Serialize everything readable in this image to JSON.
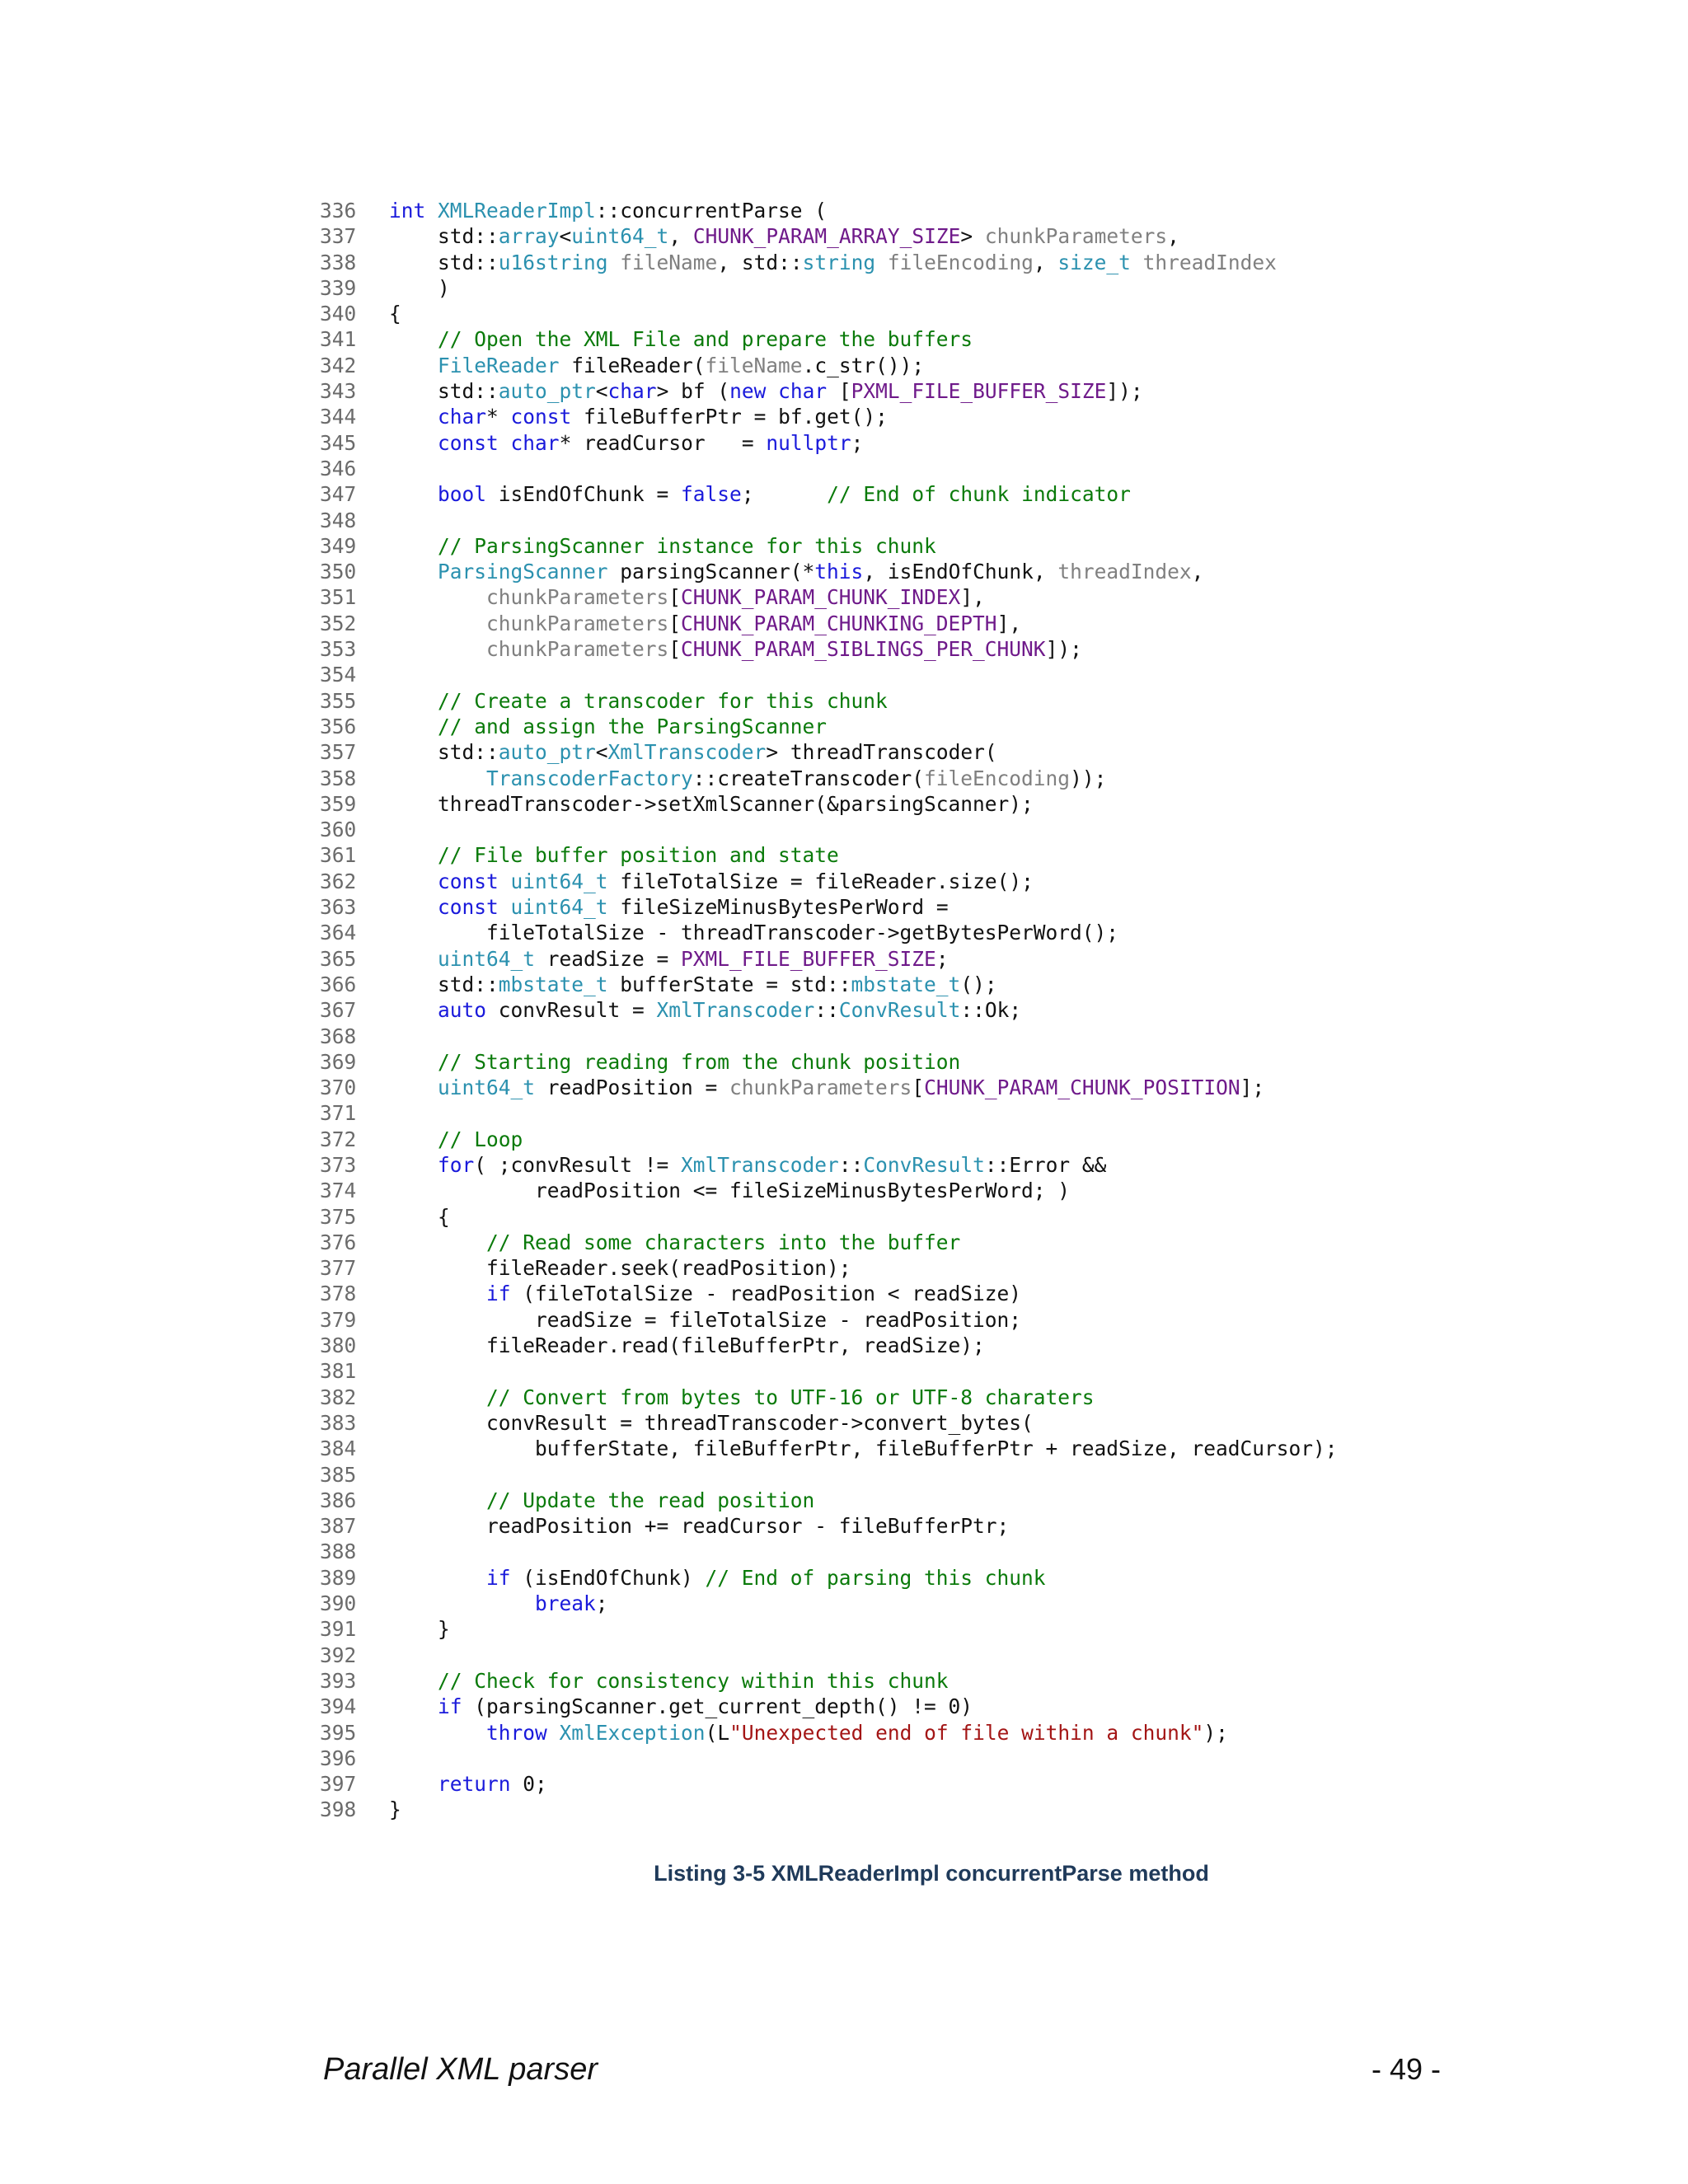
{
  "colors": {
    "keyword": "#1a1adb",
    "type": "#2b91af",
    "macro": "#6f1a8a",
    "variable": "#808080",
    "comment": "#0a7a0a",
    "string": "#a31515",
    "plain": "#111111",
    "line_number": "#6b6b6b",
    "caption": "#1f3a5a"
  },
  "code": {
    "lines": [
      {
        "num": "336",
        "tokens": [
          [
            "kw",
            "int"
          ],
          [
            "pl",
            " "
          ],
          [
            "ty",
            "XMLReaderImpl"
          ],
          [
            "pl",
            "::concurrentParse ("
          ]
        ]
      },
      {
        "num": "337",
        "tokens": [
          [
            "pl",
            "    std::"
          ],
          [
            "ty",
            "array"
          ],
          [
            "pl",
            "<"
          ],
          [
            "ty",
            "uint64_t"
          ],
          [
            "pl",
            ", "
          ],
          [
            "mac",
            "CHUNK_PARAM_ARRAY_SIZE"
          ],
          [
            "pl",
            "> "
          ],
          [
            "var",
            "chunkParameters"
          ],
          [
            "pl",
            ","
          ]
        ]
      },
      {
        "num": "338",
        "tokens": [
          [
            "pl",
            "    std::"
          ],
          [
            "ty",
            "u16string"
          ],
          [
            "pl",
            " "
          ],
          [
            "var",
            "fileName"
          ],
          [
            "pl",
            ", std::"
          ],
          [
            "ty",
            "string"
          ],
          [
            "pl",
            " "
          ],
          [
            "var",
            "fileEncoding"
          ],
          [
            "pl",
            ", "
          ],
          [
            "ty",
            "size_t"
          ],
          [
            "pl",
            " "
          ],
          [
            "var",
            "threadIndex"
          ]
        ]
      },
      {
        "num": "339",
        "tokens": [
          [
            "pl",
            "    )"
          ]
        ]
      },
      {
        "num": "340",
        "tokens": [
          [
            "pl",
            "{"
          ]
        ]
      },
      {
        "num": "341",
        "tokens": [
          [
            "pl",
            "    "
          ],
          [
            "cm",
            "// Open the XML File and prepare the buffers"
          ]
        ]
      },
      {
        "num": "342",
        "tokens": [
          [
            "pl",
            "    "
          ],
          [
            "ty",
            "FileReader"
          ],
          [
            "pl",
            " fileReader("
          ],
          [
            "var",
            "fileName"
          ],
          [
            "pl",
            ".c_str());"
          ]
        ]
      },
      {
        "num": "343",
        "tokens": [
          [
            "pl",
            "    std::"
          ],
          [
            "ty",
            "auto_ptr"
          ],
          [
            "pl",
            "<"
          ],
          [
            "kw",
            "char"
          ],
          [
            "pl",
            "> bf ("
          ],
          [
            "kw",
            "new"
          ],
          [
            "pl",
            " "
          ],
          [
            "kw",
            "char"
          ],
          [
            "pl",
            " ["
          ],
          [
            "mac",
            "PXML_FILE_BUFFER_SIZE"
          ],
          [
            "pl",
            "]);"
          ]
        ]
      },
      {
        "num": "344",
        "tokens": [
          [
            "pl",
            "    "
          ],
          [
            "kw",
            "char"
          ],
          [
            "pl",
            "* "
          ],
          [
            "kw",
            "const"
          ],
          [
            "pl",
            " fileBufferPtr = bf.get();"
          ]
        ]
      },
      {
        "num": "345",
        "tokens": [
          [
            "pl",
            "    "
          ],
          [
            "kw",
            "const"
          ],
          [
            "pl",
            " "
          ],
          [
            "kw",
            "char"
          ],
          [
            "pl",
            "* readCursor   = "
          ],
          [
            "kw",
            "nullptr"
          ],
          [
            "pl",
            ";"
          ]
        ]
      },
      {
        "num": "346",
        "tokens": []
      },
      {
        "num": "347",
        "tokens": [
          [
            "pl",
            "    "
          ],
          [
            "kw",
            "bool"
          ],
          [
            "pl",
            " isEndOfChunk = "
          ],
          [
            "kw",
            "false"
          ],
          [
            "pl",
            ";      "
          ],
          [
            "cm",
            "// End of chunk indicator"
          ]
        ]
      },
      {
        "num": "348",
        "tokens": []
      },
      {
        "num": "349",
        "tokens": [
          [
            "pl",
            "    "
          ],
          [
            "cm",
            "// ParsingScanner instance for this chunk"
          ]
        ]
      },
      {
        "num": "350",
        "tokens": [
          [
            "pl",
            "    "
          ],
          [
            "ty",
            "ParsingScanner"
          ],
          [
            "pl",
            " parsingScanner(*"
          ],
          [
            "kw",
            "this"
          ],
          [
            "pl",
            ", isEndOfChunk, "
          ],
          [
            "var",
            "threadIndex"
          ],
          [
            "pl",
            ","
          ]
        ]
      },
      {
        "num": "351",
        "tokens": [
          [
            "pl",
            "        "
          ],
          [
            "var",
            "chunkParameters"
          ],
          [
            "pl",
            "["
          ],
          [
            "mac",
            "CHUNK_PARAM_CHUNK_INDEX"
          ],
          [
            "pl",
            "],"
          ]
        ]
      },
      {
        "num": "352",
        "tokens": [
          [
            "pl",
            "        "
          ],
          [
            "var",
            "chunkParameters"
          ],
          [
            "pl",
            "["
          ],
          [
            "mac",
            "CHUNK_PARAM_CHUNKING_DEPTH"
          ],
          [
            "pl",
            "],"
          ]
        ]
      },
      {
        "num": "353",
        "tokens": [
          [
            "pl",
            "        "
          ],
          [
            "var",
            "chunkParameters"
          ],
          [
            "pl",
            "["
          ],
          [
            "mac",
            "CHUNK_PARAM_SIBLINGS_PER_CHUNK"
          ],
          [
            "pl",
            "]);"
          ]
        ]
      },
      {
        "num": "354",
        "tokens": []
      },
      {
        "num": "355",
        "tokens": [
          [
            "pl",
            "    "
          ],
          [
            "cm",
            "// Create a transcoder for this chunk"
          ]
        ]
      },
      {
        "num": "356",
        "tokens": [
          [
            "pl",
            "    "
          ],
          [
            "cm",
            "// and assign the ParsingScanner"
          ]
        ]
      },
      {
        "num": "357",
        "tokens": [
          [
            "pl",
            "    std::"
          ],
          [
            "ty",
            "auto_ptr"
          ],
          [
            "pl",
            "<"
          ],
          [
            "ty",
            "XmlTranscoder"
          ],
          [
            "pl",
            "> threadTranscoder("
          ]
        ]
      },
      {
        "num": "358",
        "tokens": [
          [
            "pl",
            "        "
          ],
          [
            "ty",
            "TranscoderFactory"
          ],
          [
            "pl",
            "::createTranscoder("
          ],
          [
            "var",
            "fileEncoding"
          ],
          [
            "pl",
            "));"
          ]
        ]
      },
      {
        "num": "359",
        "tokens": [
          [
            "pl",
            "    threadTranscoder->setXmlScanner(&parsingScanner);"
          ]
        ]
      },
      {
        "num": "360",
        "tokens": []
      },
      {
        "num": "361",
        "tokens": [
          [
            "pl",
            "    "
          ],
          [
            "cm",
            "// File buffer position and state"
          ]
        ]
      },
      {
        "num": "362",
        "tokens": [
          [
            "pl",
            "    "
          ],
          [
            "kw",
            "const"
          ],
          [
            "pl",
            " "
          ],
          [
            "ty",
            "uint64_t"
          ],
          [
            "pl",
            " fileTotalSize = fileReader.size();"
          ]
        ]
      },
      {
        "num": "363",
        "tokens": [
          [
            "pl",
            "    "
          ],
          [
            "kw",
            "const"
          ],
          [
            "pl",
            " "
          ],
          [
            "ty",
            "uint64_t"
          ],
          [
            "pl",
            " fileSizeMinusBytesPerWord ="
          ]
        ]
      },
      {
        "num": "364",
        "tokens": [
          [
            "pl",
            "        fileTotalSize - threadTranscoder->getBytesPerWord();"
          ]
        ]
      },
      {
        "num": "365",
        "tokens": [
          [
            "pl",
            "    "
          ],
          [
            "ty",
            "uint64_t"
          ],
          [
            "pl",
            " readSize = "
          ],
          [
            "mac",
            "PXML_FILE_BUFFER_SIZE"
          ],
          [
            "pl",
            ";"
          ]
        ]
      },
      {
        "num": "366",
        "tokens": [
          [
            "pl",
            "    std::"
          ],
          [
            "ty",
            "mbstate_t"
          ],
          [
            "pl",
            " bufferState = std::"
          ],
          [
            "ty",
            "mbstate_t"
          ],
          [
            "pl",
            "();"
          ]
        ]
      },
      {
        "num": "367",
        "tokens": [
          [
            "pl",
            "    "
          ],
          [
            "kw",
            "auto"
          ],
          [
            "pl",
            " convResult = "
          ],
          [
            "ty",
            "XmlTranscoder"
          ],
          [
            "pl",
            "::"
          ],
          [
            "ty",
            "ConvResult"
          ],
          [
            "pl",
            "::Ok;"
          ]
        ]
      },
      {
        "num": "368",
        "tokens": []
      },
      {
        "num": "369",
        "tokens": [
          [
            "pl",
            "    "
          ],
          [
            "cm",
            "// Starting reading from the chunk position"
          ]
        ]
      },
      {
        "num": "370",
        "tokens": [
          [
            "pl",
            "    "
          ],
          [
            "ty",
            "uint64_t"
          ],
          [
            "pl",
            " readPosition = "
          ],
          [
            "var",
            "chunkParameters"
          ],
          [
            "pl",
            "["
          ],
          [
            "mac",
            "CHUNK_PARAM_CHUNK_POSITION"
          ],
          [
            "pl",
            "];"
          ]
        ]
      },
      {
        "num": "371",
        "tokens": []
      },
      {
        "num": "372",
        "tokens": [
          [
            "pl",
            "    "
          ],
          [
            "cm",
            "// Loop"
          ]
        ]
      },
      {
        "num": "373",
        "tokens": [
          [
            "pl",
            "    "
          ],
          [
            "kw",
            "for"
          ],
          [
            "pl",
            "( ;convResult != "
          ],
          [
            "ty",
            "XmlTranscoder"
          ],
          [
            "pl",
            "::"
          ],
          [
            "ty",
            "ConvResult"
          ],
          [
            "pl",
            "::Error &&"
          ]
        ]
      },
      {
        "num": "374",
        "tokens": [
          [
            "pl",
            "            readPosition <= fileSizeMinusBytesPerWord; )"
          ]
        ]
      },
      {
        "num": "375",
        "tokens": [
          [
            "pl",
            "    {"
          ]
        ]
      },
      {
        "num": "376",
        "tokens": [
          [
            "pl",
            "        "
          ],
          [
            "cm",
            "// Read some characters into the buffer"
          ]
        ]
      },
      {
        "num": "377",
        "tokens": [
          [
            "pl",
            "        fileReader.seek(readPosition);"
          ]
        ]
      },
      {
        "num": "378",
        "tokens": [
          [
            "pl",
            "        "
          ],
          [
            "kw",
            "if"
          ],
          [
            "pl",
            " (fileTotalSize - readPosition < readSize)"
          ]
        ]
      },
      {
        "num": "379",
        "tokens": [
          [
            "pl",
            "            readSize = fileTotalSize - readPosition;"
          ]
        ]
      },
      {
        "num": "380",
        "tokens": [
          [
            "pl",
            "        fileReader.read(fileBufferPtr, readSize);"
          ]
        ]
      },
      {
        "num": "381",
        "tokens": []
      },
      {
        "num": "382",
        "tokens": [
          [
            "pl",
            "        "
          ],
          [
            "cm",
            "// Convert from bytes to UTF-16 or UTF-8 charaters"
          ]
        ]
      },
      {
        "num": "383",
        "tokens": [
          [
            "pl",
            "        convResult = threadTranscoder->convert_bytes("
          ]
        ]
      },
      {
        "num": "384",
        "tokens": [
          [
            "pl",
            "            bufferState, fileBufferPtr, fileBufferPtr + readSize, readCursor);"
          ]
        ]
      },
      {
        "num": "385",
        "tokens": []
      },
      {
        "num": "386",
        "tokens": [
          [
            "pl",
            "        "
          ],
          [
            "cm",
            "// Update the read position"
          ]
        ]
      },
      {
        "num": "387",
        "tokens": [
          [
            "pl",
            "        readPosition += readCursor - fileBufferPtr;"
          ]
        ]
      },
      {
        "num": "388",
        "tokens": []
      },
      {
        "num": "389",
        "tokens": [
          [
            "pl",
            "        "
          ],
          [
            "kw",
            "if"
          ],
          [
            "pl",
            " (isEndOfChunk) "
          ],
          [
            "cm",
            "// End of parsing this chunk"
          ]
        ]
      },
      {
        "num": "390",
        "tokens": [
          [
            "pl",
            "            "
          ],
          [
            "kw",
            "break"
          ],
          [
            "pl",
            ";"
          ]
        ]
      },
      {
        "num": "391",
        "tokens": [
          [
            "pl",
            "    }"
          ]
        ]
      },
      {
        "num": "392",
        "tokens": []
      },
      {
        "num": "393",
        "tokens": [
          [
            "pl",
            "    "
          ],
          [
            "cm",
            "// Check for consistency within this chunk"
          ]
        ]
      },
      {
        "num": "394",
        "tokens": [
          [
            "pl",
            "    "
          ],
          [
            "kw",
            "if"
          ],
          [
            "pl",
            " (parsingScanner.get_current_depth() != 0)"
          ]
        ]
      },
      {
        "num": "395",
        "tokens": [
          [
            "pl",
            "        "
          ],
          [
            "kw",
            "throw"
          ],
          [
            "pl",
            " "
          ],
          [
            "ty",
            "XmlException"
          ],
          [
            "pl",
            "(L"
          ],
          [
            "str",
            "\"Unexpected end of file within a chunk\""
          ],
          [
            "pl",
            ");"
          ]
        ]
      },
      {
        "num": "396",
        "tokens": []
      },
      {
        "num": "397",
        "tokens": [
          [
            "pl",
            "    "
          ],
          [
            "kw",
            "return"
          ],
          [
            "pl",
            " 0;"
          ]
        ]
      },
      {
        "num": "398",
        "tokens": [
          [
            "pl",
            "}"
          ]
        ]
      }
    ]
  },
  "caption": "Listing 3-5 XMLReaderImpl concurrentParse method",
  "footer": {
    "title": "Parallel XML parser",
    "page": "- 49 -"
  }
}
